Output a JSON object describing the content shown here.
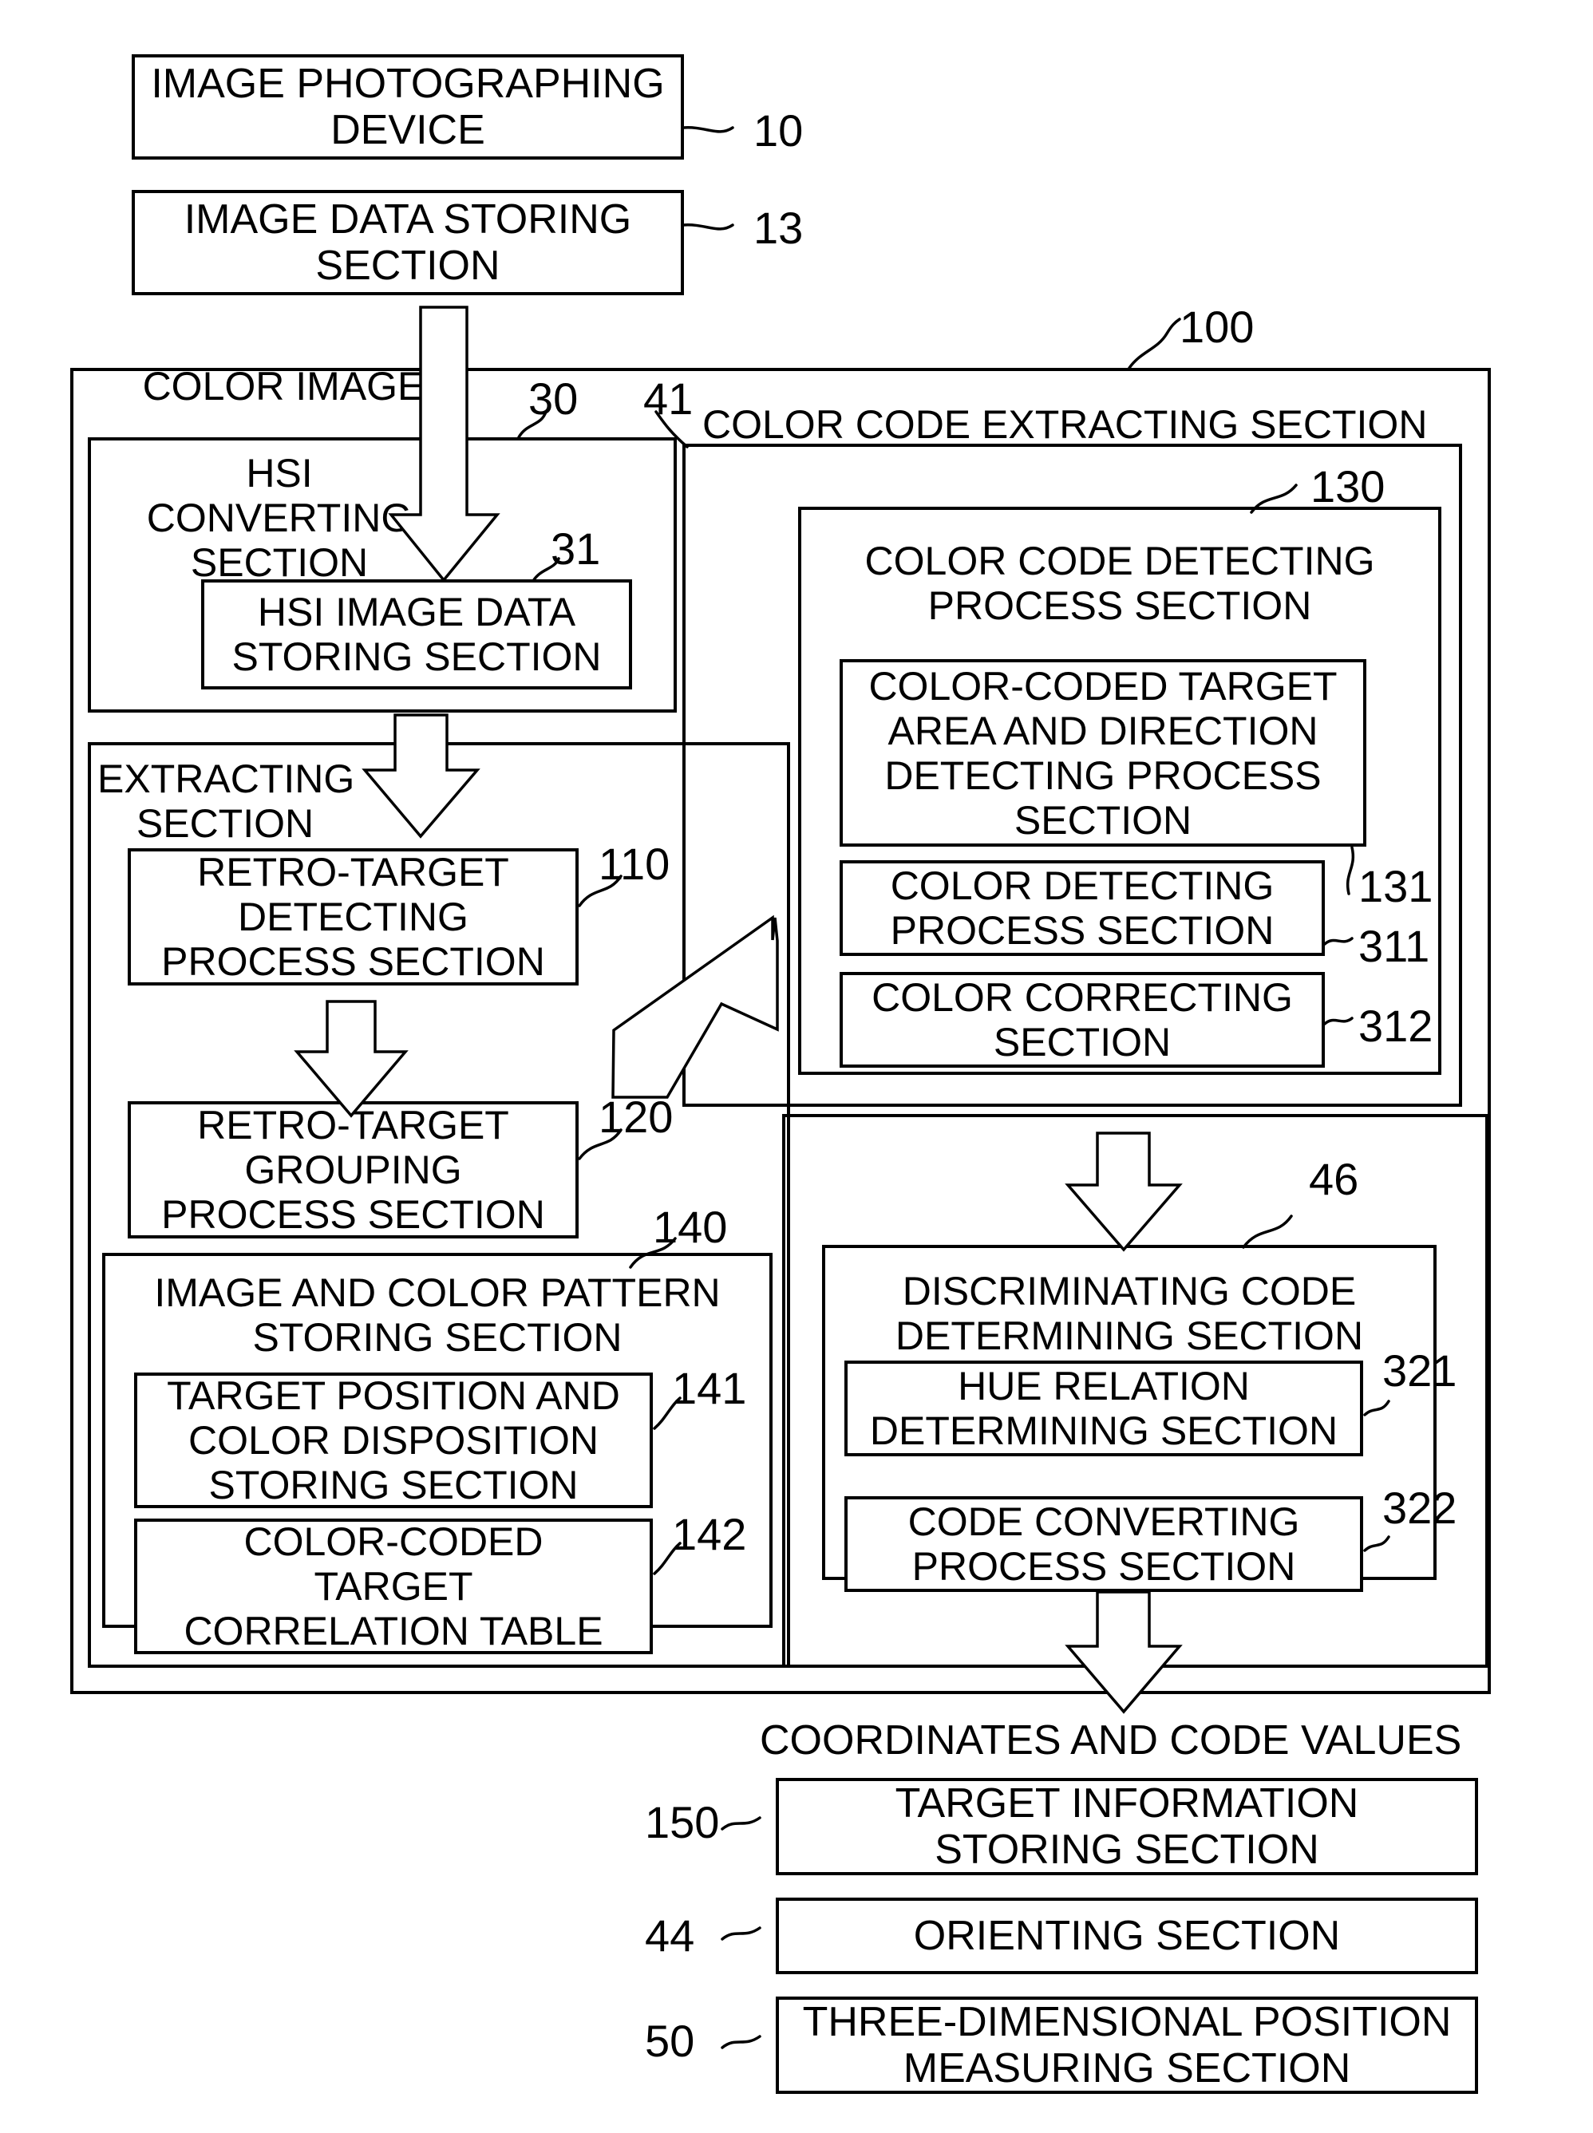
{
  "figure": {
    "type": "patent-block-diagram",
    "title_text_blocks": {
      "color_image_label": "COLOR IMAGE",
      "coordinates_label": "COORDINATES AND CODE VALUES"
    },
    "boxes": {
      "image_photographing_device": "IMAGE PHOTOGRAPHING\nDEVICE",
      "image_data_storing_section": "IMAGE DATA STORING\nSECTION",
      "hsi_converting_section": "HSI\nCONVERTING\nSECTION",
      "hsi_image_data_storing_section": "HSI IMAGE DATA\nSTORING SECTION",
      "color_code_extracting_section": "COLOR CODE EXTRACTING SECTION",
      "color_code_detecting_process_section": "COLOR CODE DETECTING\nPROCESS SECTION",
      "color_coded_target_area_and_direction": "COLOR-CODED TARGET\nAREA AND DIRECTION\nDETECTING PROCESS\nSECTION",
      "color_detecting_process_section": "COLOR DETECTING\nPROCESS SECTION",
      "color_correcting_section": "COLOR CORRECTING\nSECTION",
      "extracting_section": "EXTRACTING\nSECTION",
      "retro_target_detecting_process_section": "RETRO-TARGET\nDETECTING\nPROCESS SECTION",
      "retro_target_grouping_process_section": "RETRO-TARGET\nGROUPING\nPROCESS SECTION",
      "image_and_color_pattern_storing_section": "IMAGE AND COLOR PATTERN\nSTORING SECTION",
      "target_position_and_color_disposition": "TARGET POSITION AND\nCOLOR DISPOSITION\nSTORING SECTION",
      "color_coded_target_correlation_table": "COLOR-CODED\nTARGET\nCORRELATION TABLE",
      "discriminating_code_determining_section": "DISCRIMINATING CODE\nDETERMINING SECTION",
      "hue_relation_determining_section": "HUE RELATION\nDETERMINING SECTION",
      "code_converting_process_section": "CODE CONVERTING\nPROCESS SECTION",
      "target_information_storing_section": "TARGET INFORMATION\nSTORING SECTION",
      "orienting_section": "ORIENTING SECTION",
      "three_dimensional_position_measuring_section": "THREE-DIMENSIONAL POSITION\nMEASURING SECTION"
    },
    "reference_numerals": {
      "n10": "10",
      "n13": "13",
      "n100": "100",
      "n30": "30",
      "n41": "41",
      "n31": "31",
      "n130": "130",
      "n131": "131",
      "n311": "311",
      "n312": "312",
      "n110": "110",
      "n120": "120",
      "n140": "140",
      "n141": "141",
      "n142": "142",
      "n46": "46",
      "n321": "321",
      "n322": "322",
      "n150": "150",
      "n44": "44",
      "n50": "50"
    },
    "colors": {
      "stroke": "#000000",
      "fill": "#ffffff"
    }
  }
}
